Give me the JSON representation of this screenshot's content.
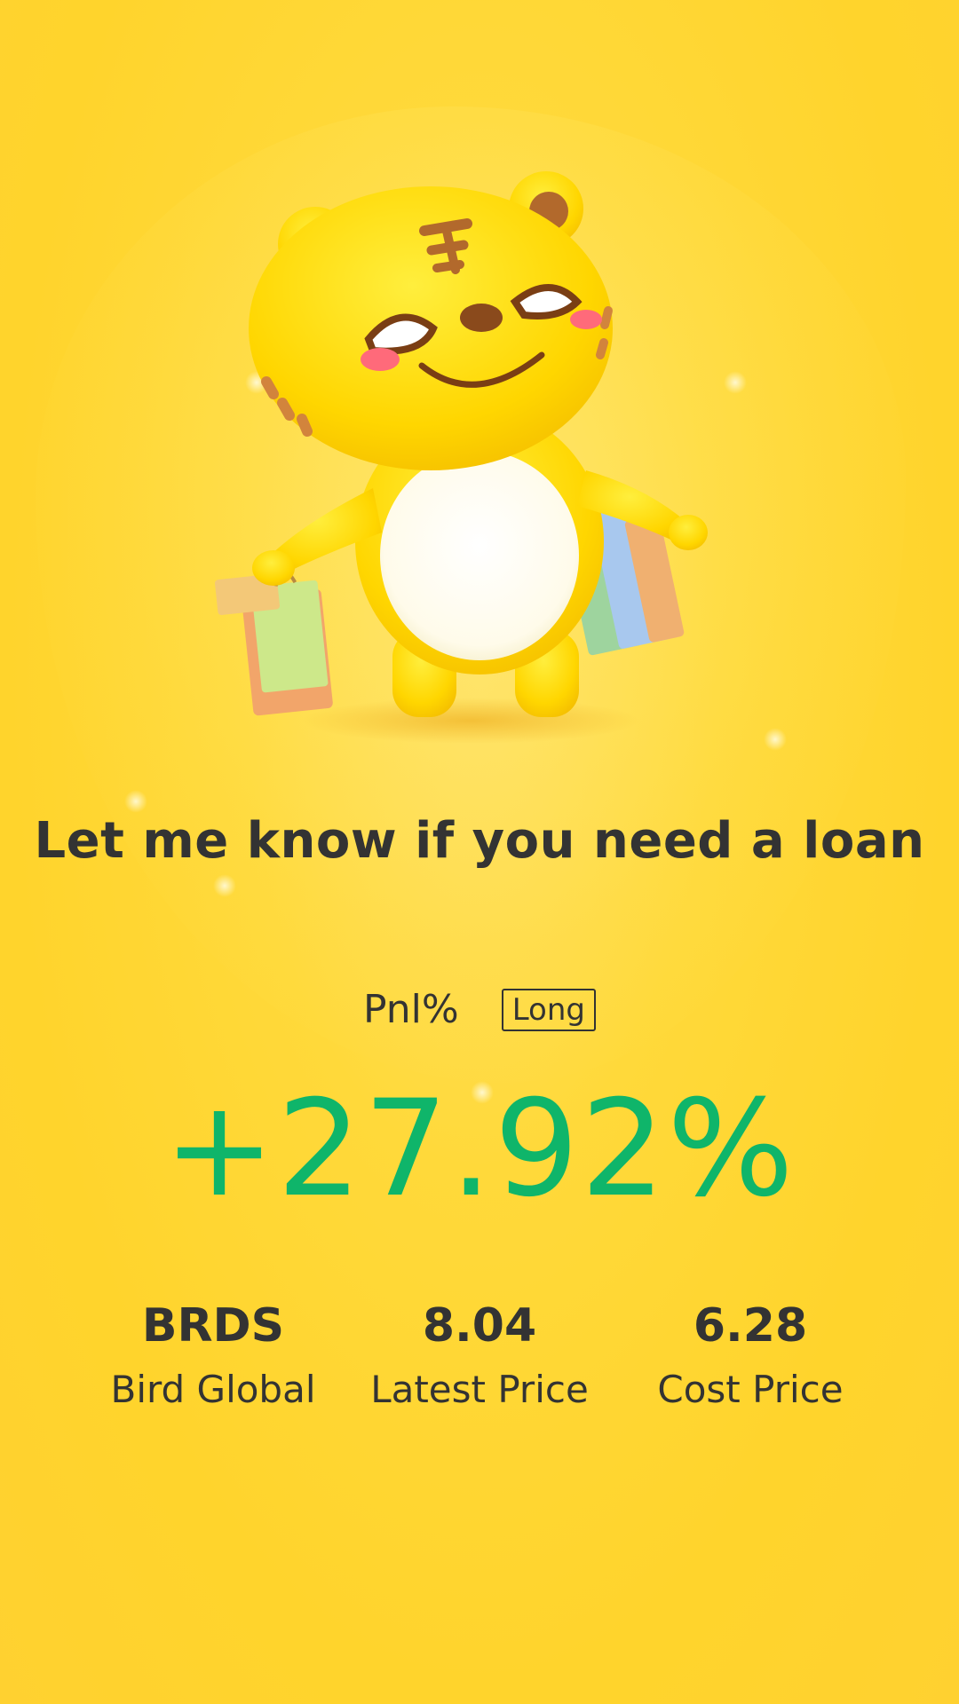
{
  "mascot": {
    "icon": "tiger-mascot-with-shopping-bags-icon"
  },
  "headline": "Let me know if you need a loan",
  "pnl": {
    "label": "Pnl%",
    "badge": "Long",
    "value": "+27.92%",
    "value_color": "#0fb56a"
  },
  "stats": [
    {
      "value": "BRDS",
      "label": "Bird Global"
    },
    {
      "value": "8.04",
      "label": "Latest Price"
    },
    {
      "value": "6.28",
      "label": "Cost Price"
    }
  ],
  "colors": {
    "background": "#ffd42c",
    "text": "#333333",
    "positive": "#0fb56a"
  }
}
